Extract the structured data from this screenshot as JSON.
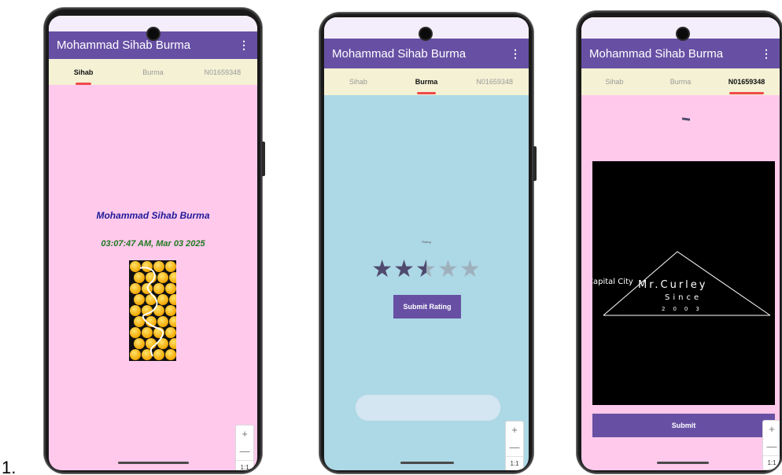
{
  "list_marker": "1.",
  "app": {
    "title": "Mohammad Sihab Burma",
    "menu_icon": "⋮",
    "tabs": [
      "Sihab",
      "Burma",
      "N01659348"
    ]
  },
  "screen1": {
    "name": "Mohammad Sihab Burma",
    "datetime": "03:07:47 AM, Mar 03 2025"
  },
  "screen2": {
    "rating_label": "Rating",
    "stars": 5,
    "rating": 2.5,
    "submit_label": "Submit Rating"
  },
  "screen3": {
    "logo": {
      "left_text": "Capital City",
      "brand": "Mr.Curley",
      "since": "Since",
      "year": "2003"
    },
    "submit_label": "Submit"
  },
  "zoom": {
    "plus": "+",
    "minus": "—",
    "ratio": "1:1"
  },
  "colors": {
    "app_bar": "#6750a4",
    "tab_row": "#f4f1d4",
    "indicator": "#ef4a4a",
    "screen1_bg": "#ffc9ec",
    "screen2_bg": "#add8e6",
    "screen3_bg": "#ffc9ec",
    "name_text": "#1e1a9a",
    "date_text": "#1f7a1f"
  }
}
